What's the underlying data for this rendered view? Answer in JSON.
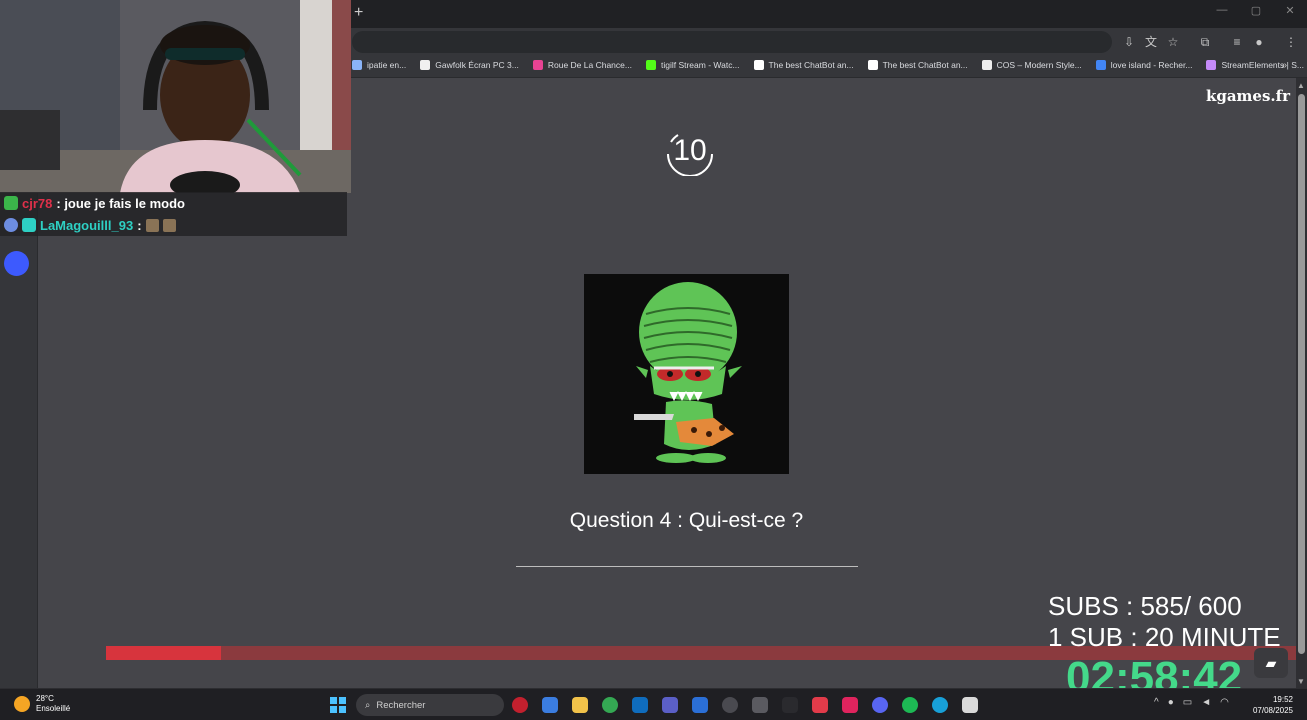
{
  "browser": {
    "new_tab_label": "+",
    "window_controls": {
      "minimize": "—",
      "restore": "▢",
      "close": "✕"
    },
    "toolbar_icons": [
      "install-icon",
      "translate-icon",
      "star-icon",
      "extensions-icon",
      "media-icon",
      "profile-icon",
      "menu-icon"
    ],
    "bookmarks": [
      {
        "label": "ipatie en...",
        "color": "#8ab4f8"
      },
      {
        "label": "Gawfolk Écran PC 3...",
        "color": "#f0f0f0"
      },
      {
        "label": "Roue De La Chance...",
        "color": "#e84393"
      },
      {
        "label": "tigilf Stream - Watc...",
        "color": "#53fc18"
      },
      {
        "label": "The best ChatBot an...",
        "color": "#ffffff"
      },
      {
        "label": "The best ChatBot an...",
        "color": "#ffffff"
      },
      {
        "label": "COS – Modern Style...",
        "color": "#eeeeee"
      },
      {
        "label": "love island - Recher...",
        "color": "#4285f4"
      },
      {
        "label": "StreamElements | S...",
        "color": "#c58af9"
      }
    ],
    "more_bookmarks": "»"
  },
  "page": {
    "brand": "kgames.fr",
    "timer": "10",
    "question": "Question 4 : Qui-est-ce ?",
    "progress_fraction": 0.097,
    "accent_color": "#d7343d"
  },
  "chat": [
    {
      "user": "cjr78",
      "message": ": joue je fais le modo"
    },
    {
      "user": "LaMagouilll_93",
      "message": ":"
    }
  ],
  "overlay": {
    "subs": "SUBS : 585/ 600",
    "rule": "1 SUB :  20 MINUTE",
    "countdown": "02:58:42",
    "countdown_color": "#44d98a"
  },
  "taskbar": {
    "weather_temp": "28°C",
    "weather_desc": "Ensoleillé",
    "search_placeholder": "Rechercher",
    "time": "19:52",
    "date": "07/08/2025"
  }
}
